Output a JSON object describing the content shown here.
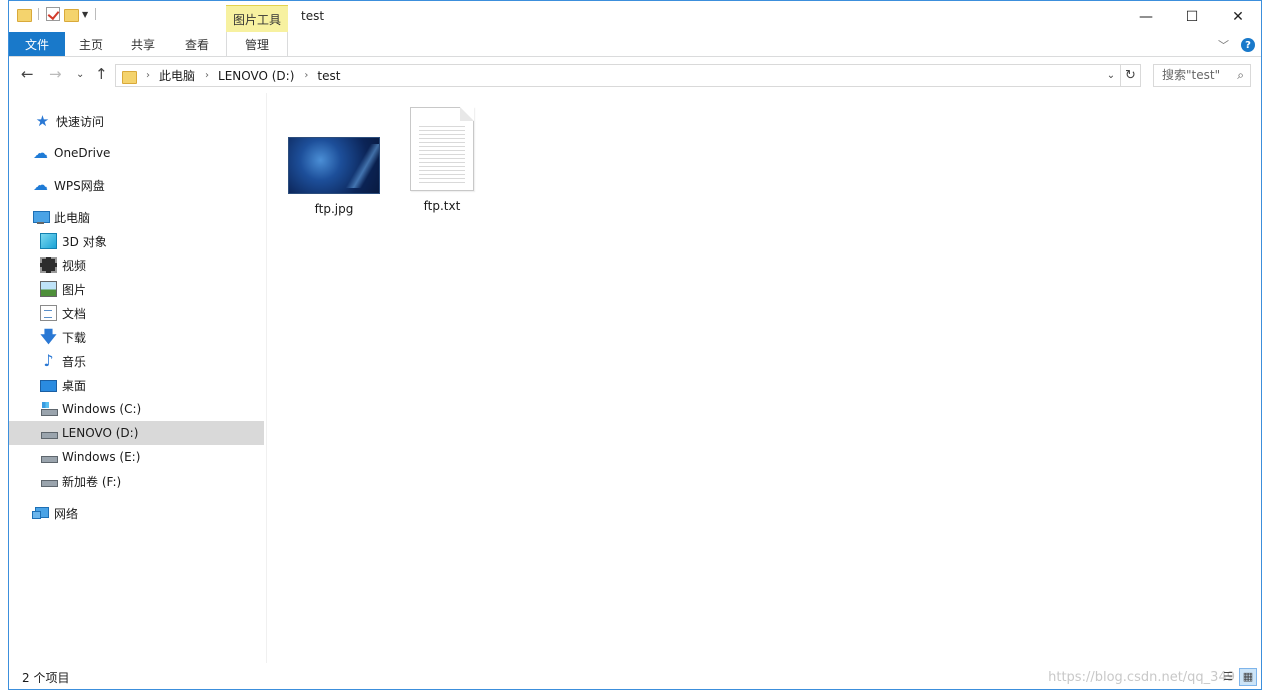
{
  "window": {
    "title": "test",
    "context_tab": "图片工具",
    "controls": {
      "minimize": "—",
      "maximize": "☐",
      "close": "✕"
    }
  },
  "ribbon": {
    "tabs": [
      "文件",
      "主页",
      "共享",
      "查看",
      "管理"
    ],
    "active_tab": "文件",
    "help": "?"
  },
  "address": {
    "crumbs": [
      "此电脑",
      "LENOVO (D:)",
      "test"
    ],
    "search_placeholder": "搜索\"test\""
  },
  "sidebar": {
    "items": [
      {
        "label": "快速访问",
        "icon": "star-icon"
      },
      {
        "label": "OneDrive",
        "icon": "onedrive-icon"
      },
      {
        "label": "WPS网盘",
        "icon": "cloud-icon"
      },
      {
        "label": "此电脑",
        "icon": "computer-icon"
      },
      {
        "label": "3D 对象",
        "icon": "cube-icon"
      },
      {
        "label": "视频",
        "icon": "video-icon"
      },
      {
        "label": "图片",
        "icon": "picture-icon"
      },
      {
        "label": "文档",
        "icon": "document-icon"
      },
      {
        "label": "下载",
        "icon": "download-icon"
      },
      {
        "label": "音乐",
        "icon": "music-icon"
      },
      {
        "label": "桌面",
        "icon": "desktop-icon"
      },
      {
        "label": "Windows (C:)",
        "icon": "system-drive-icon"
      },
      {
        "label": "LENOVO (D:)",
        "icon": "drive-icon"
      },
      {
        "label": "Windows (E:)",
        "icon": "drive-icon"
      },
      {
        "label": "新加卷 (F:)",
        "icon": "drive-icon"
      },
      {
        "label": "网络",
        "icon": "network-icon"
      }
    ],
    "selected": "LENOVO (D:)"
  },
  "files": [
    {
      "name": "ftp.jpg",
      "type": "image"
    },
    {
      "name": "ftp.txt",
      "type": "text"
    }
  ],
  "status": {
    "item_count": "2 个项目",
    "watermark": "https://blog.csdn.net/qq_349"
  }
}
